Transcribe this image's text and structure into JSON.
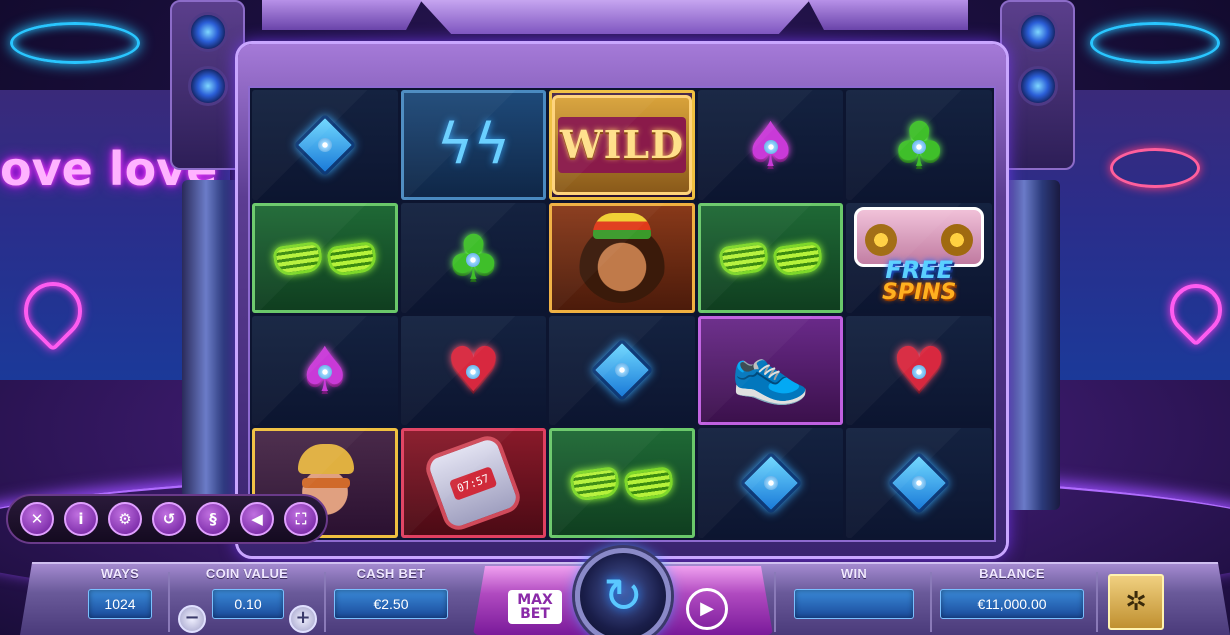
{
  "reels": {
    "rows": [
      [
        {
          "symbol": "blue-diamond",
          "frame": "none"
        },
        {
          "symbol": "lightning-earrings",
          "frame": "blue"
        },
        {
          "symbol": "wild",
          "frame": "gold",
          "text": "WILD"
        },
        {
          "symbol": "purple-spade",
          "frame": "none"
        },
        {
          "symbol": "green-club",
          "frame": "none"
        }
      ],
      [
        {
          "symbol": "green-glasses",
          "frame": "green"
        },
        {
          "symbol": "green-club",
          "frame": "none"
        },
        {
          "symbol": "woman-portrait",
          "frame": "orange"
        },
        {
          "symbol": "green-glasses",
          "frame": "green"
        },
        {
          "symbol": "free-spins-scatter",
          "frame": "none",
          "text_top": "FREE",
          "text_bottom": "SPINS"
        }
      ],
      [
        {
          "symbol": "purple-spade",
          "frame": "none"
        },
        {
          "symbol": "red-heart",
          "frame": "none"
        },
        {
          "symbol": "blue-diamond",
          "frame": "none"
        },
        {
          "symbol": "sneakers",
          "frame": "purple"
        },
        {
          "symbol": "red-heart",
          "frame": "none"
        }
      ],
      [
        {
          "symbol": "man-portrait",
          "frame": "gold"
        },
        {
          "symbol": "digital-watch",
          "frame": "red",
          "text": "07:57"
        },
        {
          "symbol": "green-glasses",
          "frame": "green"
        },
        {
          "symbol": "blue-diamond",
          "frame": "none"
        },
        {
          "symbol": "blue-diamond",
          "frame": "none"
        }
      ]
    ]
  },
  "background": {
    "neon_text": "ove love"
  },
  "side_menu": {
    "buttons": [
      {
        "name": "close",
        "glyph": "✕"
      },
      {
        "name": "info",
        "glyph": "i"
      },
      {
        "name": "settings",
        "glyph": "⚙"
      },
      {
        "name": "history",
        "glyph": "↺"
      },
      {
        "name": "rules",
        "glyph": "§"
      },
      {
        "name": "sound",
        "glyph": "◀"
      },
      {
        "name": "fullscreen",
        "glyph": "⛶"
      }
    ]
  },
  "bottom_bar": {
    "ways_label": "WAYS",
    "ways_value": "1024",
    "coin_value_label": "COIN VALUE",
    "coin_value": "0.10",
    "coin_minus": "−",
    "coin_plus": "+",
    "cash_bet_label": "CASH BET",
    "cash_bet_value": "€2.50",
    "max_bet_label": "MAX BET",
    "win_label": "WIN",
    "win_value": "",
    "balance_label": "BALANCE",
    "balance_value": "€11,000.00"
  },
  "colors": {
    "accent_purple": "#b04ac0",
    "value_blue": "#3a8ad8",
    "spin_glow": "#5ac8ff"
  }
}
